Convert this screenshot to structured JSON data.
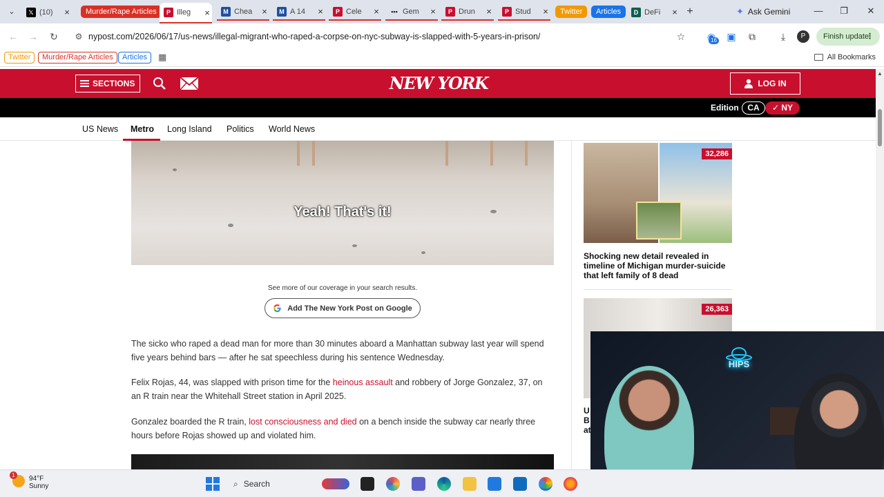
{
  "browser": {
    "tabs": [
      {
        "title": "(10)",
        "favicon": "x-logo-icon",
        "color": "#000000"
      },
      {
        "title": "Illeg",
        "favicon": "nypost-icon",
        "color": "#c8102e",
        "active": true
      },
      {
        "title": "Chea",
        "favicon": "m-icon",
        "color": "#1e4fa3"
      },
      {
        "title": "A 14",
        "favicon": "m-icon",
        "color": "#1e4fa3"
      },
      {
        "title": "Cele",
        "favicon": "nypost-icon",
        "color": "#c8102e"
      },
      {
        "title": "Gem",
        "favicon": "dots-icon",
        "color": "#222222"
      },
      {
        "title": "Drun",
        "favicon": "nypost-icon",
        "color": "#c8102e"
      },
      {
        "title": "Stud",
        "favicon": "nypost-icon",
        "color": "#c8102e"
      },
      {
        "title": "DeFi",
        "favicon": "defi-icon",
        "color": "#0f5e4f"
      }
    ],
    "tab_groups": {
      "murder": {
        "label": "Murder/Rape Articles",
        "color": "#d93025"
      },
      "twitter": {
        "label": "Twitter",
        "color": "#f29900"
      },
      "articles": {
        "label": "Articles",
        "color": "#1a73e8"
      }
    },
    "ask_gemini": "Ask Gemini",
    "url": "nypost.com/2026/06/17/us-news/illegal-migrant-who-raped-a-corpse-on-nyc-subway-is-slapped-with-5-years-in-prison/",
    "extension_badge": "16",
    "profile_initial": "P",
    "finish_update": "Finish update",
    "bookmarks": {
      "twitter": "Twitter",
      "murder": "Murder/Rape Articles",
      "articles": "Articles",
      "all": "All Bookmarks"
    }
  },
  "site": {
    "sections_label": "SECTIONS",
    "logo": "NEW YORK POST",
    "login_label": "LOG IN",
    "edition_label": "Edition",
    "edition_ca": "CA",
    "edition_ny": "✓ NY",
    "brand_color": "#c8102e",
    "subnav": [
      "US News",
      "Metro",
      "Long Island",
      "Politics",
      "World News"
    ],
    "subnav_active": "Metro"
  },
  "article": {
    "video_caption": "Yeah! That's it!",
    "coverage_note": "See more of our coverage in your search results.",
    "google_button": "Add The New York Post on Google",
    "p1": "The sicko who raped a dead man for more than 30 minutes aboard a Manhattan subway last year will spend five years behind bars — after he sat speechless during his sentence Wednesday.",
    "p2_a": "Felix Rojas, 44, was slapped with prison time for the ",
    "p2_link": "heinous assault",
    "p2_b": " and robbery of Jorge Gonzalez, 37, on an R train near the Whitehall Street station in April 2025.",
    "p3_a": "Gonzalez boarded the R train, ",
    "p3_link": "lost consciousness and died",
    "p3_b": " on a bench inside the subway car nearly three hours before Rojas showed up and violated him."
  },
  "sidebar": {
    "story1": {
      "count": "32,286",
      "title": "Shocking new detail revealed in timeline of Michigan murder-suicide that left family of 8 dead"
    },
    "story2": {
      "count": "26,363",
      "peek": "U B at"
    }
  },
  "webcam": {
    "sign": "HIPS"
  },
  "taskbar": {
    "temp": "94°F",
    "condition": "Sunny",
    "weather_badge": "1",
    "search_label": "Search"
  }
}
